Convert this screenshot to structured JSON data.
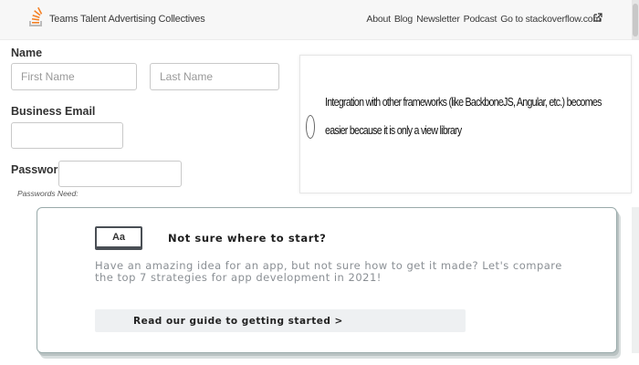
{
  "header": {
    "brand": "Teams Talent Advertising Collectives",
    "nav": [
      "About",
      "Blog",
      "Newsletter",
      "Podcast",
      "Go to stackoverflow.com"
    ],
    "logo_icon": "stack-logo-icon",
    "external_icon": "external-link-icon",
    "accent_color": "#f48024"
  },
  "form": {
    "name_label": "Name",
    "first_name_placeholder": "First Name",
    "last_name_placeholder": "Last Name",
    "email_label": "Business Email",
    "email_value": "",
    "password_label": "Password",
    "password_value": "",
    "password_hint": "Passwords Need:"
  },
  "quiz": {
    "option_text": "Integration with other frameworks (like BackboneJS, Angular, etc.) becomes easier because it is only a view library"
  },
  "guide": {
    "icon_text": "Aa",
    "title": "Not sure where to start?",
    "body": "Have an amazing idea for an app, but not sure how to get it made? Let's compare the top 7 strategies for app development in 2021!",
    "button_label": "Read our guide to getting started >"
  }
}
